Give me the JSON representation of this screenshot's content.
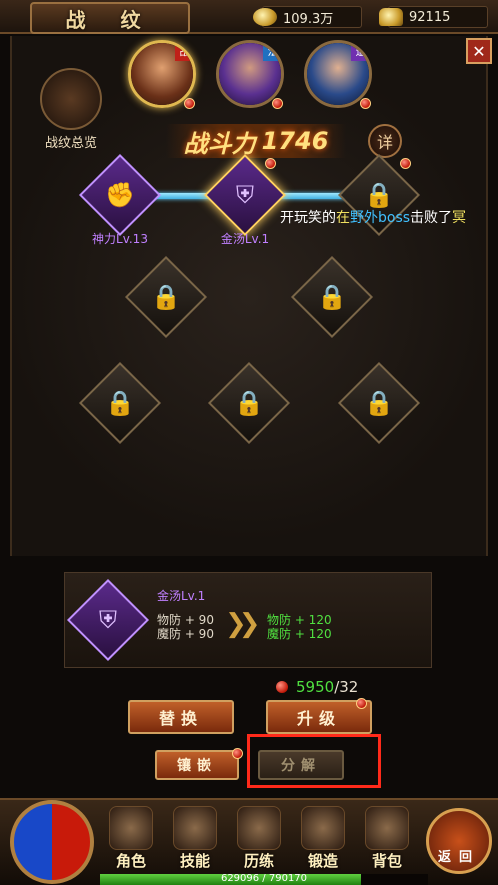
{
  "header": {
    "title": "战 纹",
    "gold": "109.3万",
    "ingot": "92115"
  },
  "overview": {
    "label": "战纹总览"
  },
  "heroes": [
    {
      "tag": "战",
      "active": true
    },
    {
      "tag": "法",
      "active": false
    },
    {
      "tag": "道",
      "active": false
    }
  ],
  "power": {
    "label": "战斗力",
    "value": "1746"
  },
  "detail_label": "详",
  "nodes": [
    {
      "label": "神力Lv.13",
      "icon": "fist-icon",
      "state": "active"
    },
    {
      "label": "金汤Lv.1",
      "icon": "shield-icon",
      "state": "selected"
    },
    {
      "label": "",
      "icon": "lock-icon",
      "state": "locked"
    },
    {
      "label": "",
      "icon": "lock-icon",
      "state": "locked"
    },
    {
      "label": "",
      "icon": "lock-icon",
      "state": "locked"
    },
    {
      "label": "",
      "icon": "lock-icon",
      "state": "locked"
    },
    {
      "label": "",
      "icon": "lock-icon",
      "state": "locked"
    },
    {
      "label": "",
      "icon": "lock-icon",
      "state": "locked"
    }
  ],
  "chat": {
    "a": "开玩笑的",
    "b": "在",
    "c": "野外boss",
    "d": "击败了",
    "e": "冥"
  },
  "info": {
    "name": "金汤Lv.1",
    "current": [
      "物防 + 90",
      "魔防 + 90"
    ],
    "next": [
      "物防 + 120",
      "魔防 + 120"
    ]
  },
  "cost": {
    "have": "5950",
    "need": "/32"
  },
  "buttons": {
    "replace": "替换",
    "upgrade": "升级",
    "inlay": "镶嵌",
    "decompose": "分解"
  },
  "nav": [
    {
      "label": "角色"
    },
    {
      "label": "技能"
    },
    {
      "label": "历练"
    },
    {
      "label": "锻造"
    },
    {
      "label": "背包"
    }
  ],
  "back_label": "返回",
  "exp": {
    "text": "629096 / 790170",
    "fraction": 0.796
  },
  "colors": {
    "active_node": "#c090ff",
    "link": "#60d0ff",
    "highlight": "#ff2a1a",
    "cost_green": "#50e040"
  }
}
